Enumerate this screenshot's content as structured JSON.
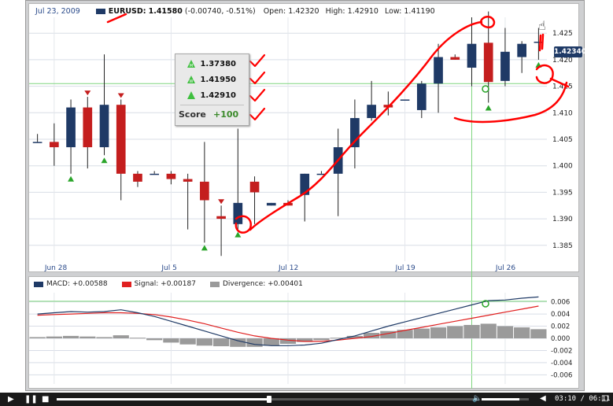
{
  "header": {
    "date": "Jul 23, 2009",
    "symbol": "EURUSD:",
    "last": "1.41580",
    "change": "(-0.00740, -0.51%)",
    "open_label": "Open:",
    "open": "1.42320",
    "high_label": "High:",
    "high": "1.42910",
    "low_label": "Low:",
    "low": "1.41190"
  },
  "price_tag": "1.42340",
  "score_box": {
    "rows": [
      {
        "icon": "green-triangle-m-icon",
        "value": "1.37380"
      },
      {
        "icon": "green-triangle-w-icon",
        "value": "1.41950"
      },
      {
        "icon": "green-triangle-icon",
        "value": "1.42910"
      }
    ],
    "score_label": "Score",
    "score_value": "+100"
  },
  "macd_legend": {
    "macd": "MACD: +0.00588",
    "signal": "Signal: +0.00187",
    "divergence": "Divergence: +0.00401"
  },
  "player": {
    "play_icon": "play-icon",
    "pause_icon": "pause-icon",
    "stop_icon": "stop-icon",
    "volume_icon": "speaker-icon",
    "fullscreen_icon": "fullscreen-icon",
    "progress_fraction": 0.51,
    "volume_fraction": 0.8,
    "timecode": "03:10 / 06:11"
  },
  "colors": {
    "up": "#1f3a66",
    "down": "#c41e1e",
    "annotation": "#ff0000",
    "macd": "#1f3a66",
    "signal": "#e02020",
    "divergence": "#9a9a9a",
    "marker": "#2aa52a"
  },
  "chart_data": [
    {
      "type": "candlestick",
      "x_tick_labels": [
        "Jun 28",
        "Jul 5",
        "Jul 12",
        "Jul 19",
        "Jul 26"
      ],
      "y_tick_labels": [
        "1.385",
        "1.390",
        "1.395",
        "1.400",
        "1.405",
        "1.410",
        "1.415",
        "1.420",
        "1.425"
      ],
      "ylim": [
        1.382,
        1.428
      ],
      "grid": true,
      "candles": [
        {
          "o": 1.4045,
          "h": 1.406,
          "l": 1.4045,
          "c": 1.4045
        },
        {
          "o": 1.4045,
          "h": 1.408,
          "l": 1.4,
          "c": 1.4035
        },
        {
          "o": 1.4035,
          "h": 1.4125,
          "l": 1.3985,
          "c": 1.411
        },
        {
          "o": 1.411,
          "h": 1.413,
          "l": 1.3995,
          "c": 1.4035
        },
        {
          "o": 1.4035,
          "h": 1.421,
          "l": 1.402,
          "c": 1.4115
        },
        {
          "o": 1.4115,
          "h": 1.4125,
          "l": 1.3935,
          "c": 1.3985
        },
        {
          "o": 1.3985,
          "h": 1.399,
          "l": 1.396,
          "c": 1.397
        },
        {
          "o": 1.3985,
          "h": 1.399,
          "l": 1.3985,
          "c": 1.3985
        },
        {
          "o": 1.3985,
          "h": 1.399,
          "l": 1.3965,
          "c": 1.3975
        },
        {
          "o": 1.3975,
          "h": 1.3985,
          "l": 1.388,
          "c": 1.397
        },
        {
          "o": 1.397,
          "h": 1.4045,
          "l": 1.3855,
          "c": 1.3935
        },
        {
          "o": 1.3905,
          "h": 1.3925,
          "l": 1.383,
          "c": 1.39
        },
        {
          "o": 1.389,
          "h": 1.407,
          "l": 1.388,
          "c": 1.393
        },
        {
          "o": 1.397,
          "h": 1.398,
          "l": 1.389,
          "c": 1.395
        },
        {
          "o": 1.3925,
          "h": 1.393,
          "l": 1.3925,
          "c": 1.393
        },
        {
          "o": 1.393,
          "h": 1.3935,
          "l": 1.3925,
          "c": 1.3925
        },
        {
          "o": 1.3945,
          "h": 1.3985,
          "l": 1.3895,
          "c": 1.3985
        },
        {
          "o": 1.3985,
          "h": 1.399,
          "l": 1.3985,
          "c": 1.3985
        },
        {
          "o": 1.3985,
          "h": 1.407,
          "l": 1.3905,
          "c": 1.4035
        },
        {
          "o": 1.4035,
          "h": 1.4125,
          "l": 1.3995,
          "c": 1.409
        },
        {
          "o": 1.409,
          "h": 1.416,
          "l": 1.4085,
          "c": 1.4115
        },
        {
          "o": 1.4115,
          "h": 1.414,
          "l": 1.4095,
          "c": 1.411
        },
        {
          "o": 1.4125,
          "h": 1.4125,
          "l": 1.4125,
          "c": 1.4125
        },
        {
          "o": 1.4105,
          "h": 1.416,
          "l": 1.409,
          "c": 1.4155
        },
        {
          "o": 1.4155,
          "h": 1.423,
          "l": 1.41,
          "c": 1.4205
        },
        {
          "o": 1.4205,
          "h": 1.421,
          "l": 1.42,
          "c": 1.42
        },
        {
          "o": 1.4185,
          "h": 1.428,
          "l": 1.415,
          "c": 1.423
        },
        {
          "o": 1.4232,
          "h": 1.4291,
          "l": 1.4119,
          "c": 1.4158
        },
        {
          "o": 1.416,
          "h": 1.426,
          "l": 1.415,
          "c": 1.4215
        },
        {
          "o": 1.4205,
          "h": 1.4235,
          "l": 1.4175,
          "c": 1.423
        },
        {
          "o": 1.4234,
          "h": 1.426,
          "l": 1.42,
          "c": 1.4234
        }
      ],
      "markers_down": [
        3,
        5,
        11
      ],
      "markers_up_below": [
        2,
        4,
        10,
        12,
        27,
        30
      ],
      "horizontal_line": 1.4155
    },
    {
      "type": "line",
      "title": "",
      "y_tick_labels": [
        "-0.006",
        "-0.004",
        "-0.002",
        "0.000",
        "0.002",
        "0.004",
        "0.006"
      ],
      "ylim": [
        -0.0075,
        0.0075
      ],
      "grid": true,
      "series": [
        {
          "name": "MACD",
          "values": [
            0.004,
            0.0042,
            0.0044,
            0.0043,
            0.0044,
            0.0047,
            0.0042,
            0.0036,
            0.0028,
            0.002,
            0.0012,
            0.0004,
            -0.0004,
            -0.001,
            -0.0012,
            -0.0012,
            -0.0011,
            -0.0008,
            -0.0002,
            0.0004,
            0.0012,
            0.002,
            0.0027,
            0.0034,
            0.0041,
            0.0048,
            0.0055,
            0.0062,
            0.0063,
            0.0066,
            0.0068
          ]
        },
        {
          "name": "Signal",
          "values": [
            0.0038,
            0.0039,
            0.004,
            0.0041,
            0.0042,
            0.0042,
            0.0041,
            0.0039,
            0.0035,
            0.003,
            0.0024,
            0.0017,
            0.001,
            0.0004,
            0.0,
            -0.0003,
            -0.0005,
            -0.0005,
            -0.0003,
            0.0,
            0.0003,
            0.0008,
            0.0013,
            0.0018,
            0.0023,
            0.0028,
            0.0033,
            0.0038,
            0.0043,
            0.0048,
            0.0053
          ]
        },
        {
          "name": "Divergence",
          "values": [
            0.0002,
            0.0003,
            0.0004,
            0.0003,
            0.0002,
            0.0005,
            0.0001,
            -0.0003,
            -0.0007,
            -0.001,
            -0.0012,
            -0.0013,
            -0.0014,
            -0.0014,
            -0.0012,
            -0.0009,
            -0.0006,
            -0.0003,
            0.0001,
            0.0004,
            0.0009,
            0.0012,
            0.0014,
            0.0016,
            0.0018,
            0.002,
            0.0022,
            0.0024,
            0.002,
            0.0018,
            0.0015
          ]
        }
      ]
    }
  ]
}
